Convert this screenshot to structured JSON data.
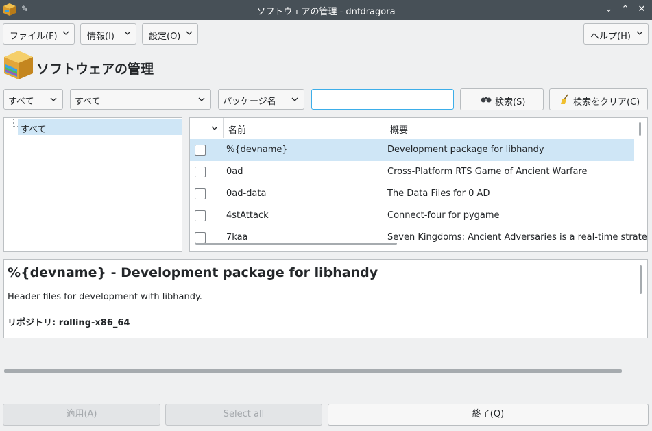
{
  "window": {
    "title": "ソフトウェアの管理 - dnfdragora",
    "pin_icon": "pin-icon",
    "min_glyph": "⌄",
    "max_glyph": "⌃",
    "close_glyph": "✕"
  },
  "menubar": {
    "file": "ファイル(F)",
    "info": "情報(I)",
    "settings": "設定(O)",
    "help": "ヘルプ(H)"
  },
  "header": {
    "title": "ソフトウェアの管理"
  },
  "filters": {
    "status": "すべて",
    "group": "すべて",
    "field": "パッケージ名",
    "search_value": ""
  },
  "actions": {
    "search": "検索(S)",
    "clear": "検索をクリア(C)"
  },
  "groups": {
    "selected": "すべて"
  },
  "packages": {
    "col_name": "名前",
    "col_summary": "概要",
    "rows": [
      {
        "name": "%{devname}",
        "summary": "Development package for libhandy"
      },
      {
        "name": "0ad",
        "summary": "Cross-Platform RTS Game of Ancient Warfare"
      },
      {
        "name": "0ad-data",
        "summary": "The Data Files for 0 AD"
      },
      {
        "name": "4stAttack",
        "summary": "Connect-four for pygame"
      },
      {
        "name": "7kaa",
        "summary": "Seven Kingdoms: Ancient Adversaries is a real-time strategy"
      }
    ]
  },
  "detail": {
    "title": "%{devname} - Development package for libhandy",
    "body": "Header files for development with libhandy.",
    "repo": "リポジトリ: rolling-x86_64"
  },
  "footer": {
    "apply": "適用(A)",
    "select_all": "Select all",
    "quit": "終了(Q)"
  },
  "colors": {
    "titlebar": "#475057",
    "selection": "#cfe6f6",
    "focus": "#3daee9"
  }
}
